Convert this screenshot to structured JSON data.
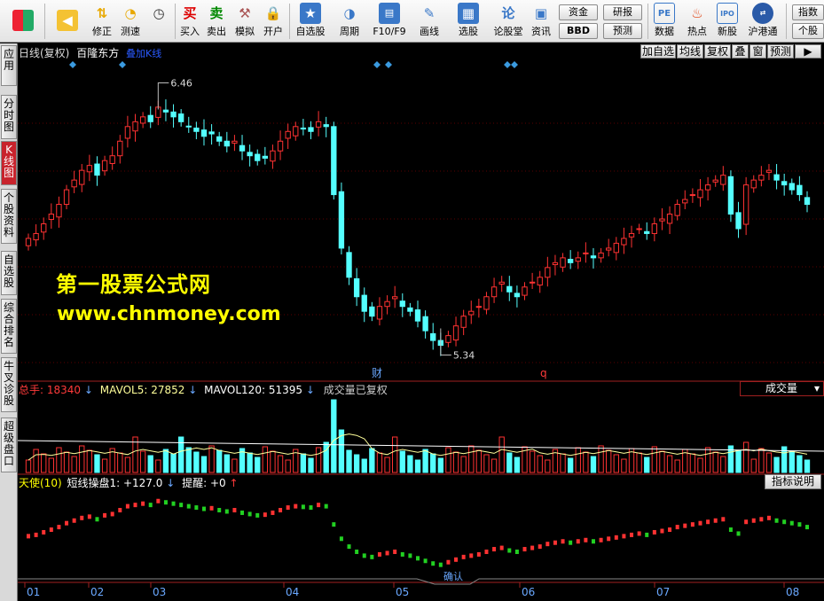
{
  "toolbar": {
    "buttons": [
      {
        "label": "",
        "icon": "logo-grid"
      },
      {
        "label": "",
        "icon": "back-arrow"
      },
      {
        "label": "修正",
        "icon": "up-down-arrows"
      },
      {
        "label": "测速",
        "icon": "clock"
      },
      {
        "label": "买入",
        "icon": "buy",
        "glyph": "买"
      },
      {
        "label": "卖出",
        "icon": "sell",
        "glyph": "卖"
      },
      {
        "label": "模拟",
        "icon": "hammer"
      },
      {
        "label": "开户",
        "icon": "lock"
      },
      {
        "label": "自选股",
        "icon": "star"
      },
      {
        "label": "周期",
        "icon": "cycle"
      },
      {
        "label": "F10/F9",
        "icon": "f10"
      },
      {
        "label": "画线",
        "icon": "pen"
      },
      {
        "label": "选股",
        "icon": "picker"
      },
      {
        "label": "论股堂",
        "icon": "forum",
        "glyph": "论"
      },
      {
        "label": "资讯",
        "icon": "news"
      },
      {
        "label": "数据",
        "icon": "pe",
        "glyph": "PE"
      },
      {
        "label": "热点",
        "icon": "hot"
      },
      {
        "label": "新股",
        "icon": "ipo",
        "glyph": "IPO"
      },
      {
        "label": "沪港通",
        "icon": "sse-hke"
      }
    ],
    "mini_buttons": {
      "fund": "资金",
      "bbd": "BBD",
      "research": "研报",
      "forecast": "预测",
      "indicator": "指数",
      "stock": "个股"
    }
  },
  "sidebar": {
    "tabs": [
      "应用",
      "分时图",
      "K线图",
      "个股资料",
      "自选股",
      "综合排名",
      "牛叉诊股",
      "超级盘口"
    ],
    "active": 2
  },
  "main_chart": {
    "period": "日线(复权)",
    "stock_name": "百隆东方",
    "style_label": "叠加K线",
    "right_buttons": [
      "加自选",
      "均线",
      "复权",
      "叠",
      "窗",
      "预测",
      "▶"
    ],
    "high_label": "6.46",
    "low_label": "5.34",
    "events": [
      {
        "text": "财"
      },
      {
        "text": "q"
      }
    ],
    "watermark_cn": "第一股票公式网",
    "watermark_url": "www.chnmoney.com"
  },
  "volume_panel": {
    "total_label": "总手:",
    "total_value": "18340",
    "mavol5_label": "MAVOL5:",
    "mavol5_value": "27852",
    "mavol120_label": "MAVOL120:",
    "mavol120_value": "51395",
    "note": "成交量已复权",
    "selector": "成交量"
  },
  "indicator_panel": {
    "name": "天使(10)",
    "line_label": "短线操盘1:",
    "line_value": "+127.0",
    "alert_label": "提醒:",
    "alert_value": "+0",
    "help_button": "指标说明",
    "confirm_label": "确认"
  },
  "x_axis": {
    "labels": [
      "01",
      "02",
      "03",
      "04",
      "05",
      "06",
      "07",
      "08"
    ]
  },
  "colors": {
    "up": "#ff3232",
    "down": "#54ffff",
    "ma": "#ffff9a",
    "yellow": "#ffff00",
    "green": "#22d022"
  },
  "chart_data": {
    "type": "candlestick",
    "price_high": 6.46,
    "price_low": 5.34,
    "close": [
      5.82,
      5.84,
      5.88,
      5.92,
      5.96,
      6.02,
      6.06,
      6.1,
      6.12,
      6.08,
      6.14,
      6.16,
      6.22,
      6.28,
      6.3,
      6.32,
      6.3,
      6.36,
      6.34,
      6.32,
      6.3,
      6.28,
      6.26,
      6.24,
      6.25,
      6.22,
      6.2,
      6.22,
      6.18,
      6.16,
      6.14,
      6.15,
      6.18,
      6.22,
      6.26,
      6.28,
      6.27,
      6.26,
      6.3,
      6.28,
      6.0,
      5.78,
      5.66,
      5.58,
      5.52,
      5.5,
      5.54,
      5.56,
      5.58,
      5.54,
      5.52,
      5.48,
      5.44,
      5.4,
      5.38,
      5.42,
      5.46,
      5.5,
      5.52,
      5.54,
      5.58,
      5.62,
      5.64,
      5.6,
      5.58,
      5.62,
      5.64,
      5.66,
      5.7,
      5.72,
      5.74,
      5.72,
      5.74,
      5.76,
      5.74,
      5.76,
      5.78,
      5.8,
      5.82,
      5.84,
      5.86,
      5.84,
      5.88,
      5.9,
      5.92,
      5.96,
      5.98,
      6.0,
      6.02,
      6.04,
      6.06,
      6.08,
      5.92,
      5.86,
      6.04,
      6.06,
      6.08,
      6.1,
      6.06,
      6.04,
      6.02,
      6.0,
      5.96
    ]
  }
}
